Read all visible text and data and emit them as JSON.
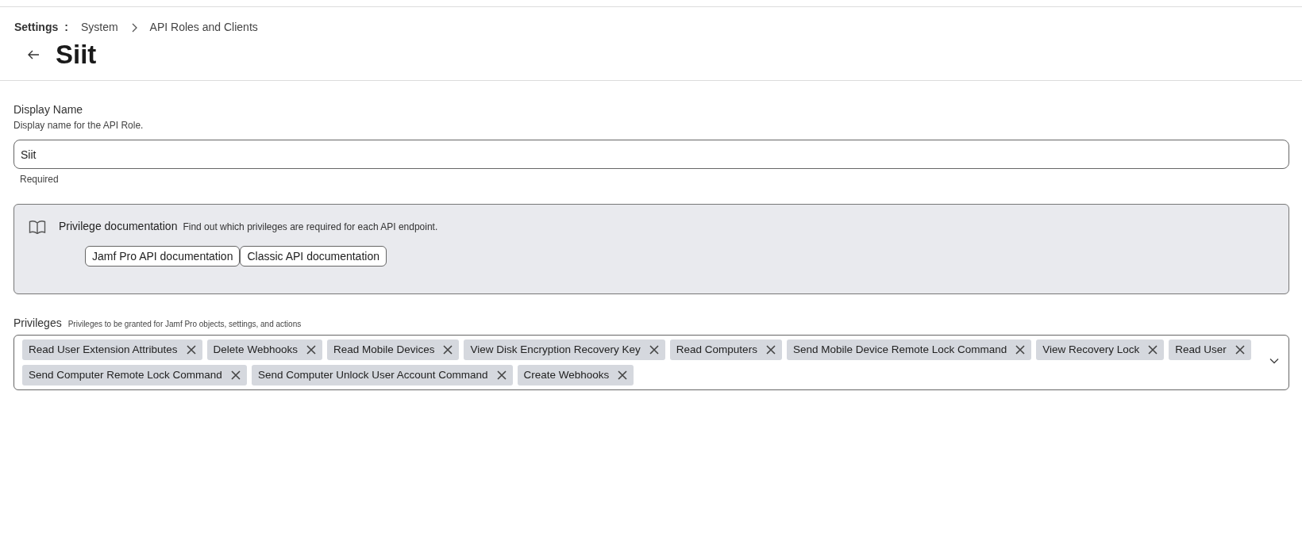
{
  "breadcrumb": {
    "root": "Settings",
    "separator": ":",
    "items": [
      "System",
      "API Roles and Clients"
    ]
  },
  "title": "Siit",
  "display_name": {
    "label": "Display Name",
    "description": "Display name for the API Role.",
    "value": "Siit",
    "helper": "Required"
  },
  "doc_panel": {
    "title": "Privilege documentation",
    "description": "Find out which privileges are required for each API endpoint.",
    "links": [
      "Jamf Pro API documentation",
      "Classic API documentation"
    ]
  },
  "privileges": {
    "label": "Privileges",
    "description": "Privileges to be granted for Jamf Pro objects, settings, and actions",
    "chips": [
      "Read User Extension Attributes",
      "Delete Webhooks",
      "Read Mobile Devices",
      "View Disk Encryption Recovery Key",
      "Read Computers",
      "Send Mobile Device Remote Lock Command",
      "View Recovery Lock",
      "Read User",
      "Send Computer Remote Lock Command",
      "Send Computer Unlock User Account Command",
      "Create Webhooks"
    ]
  }
}
